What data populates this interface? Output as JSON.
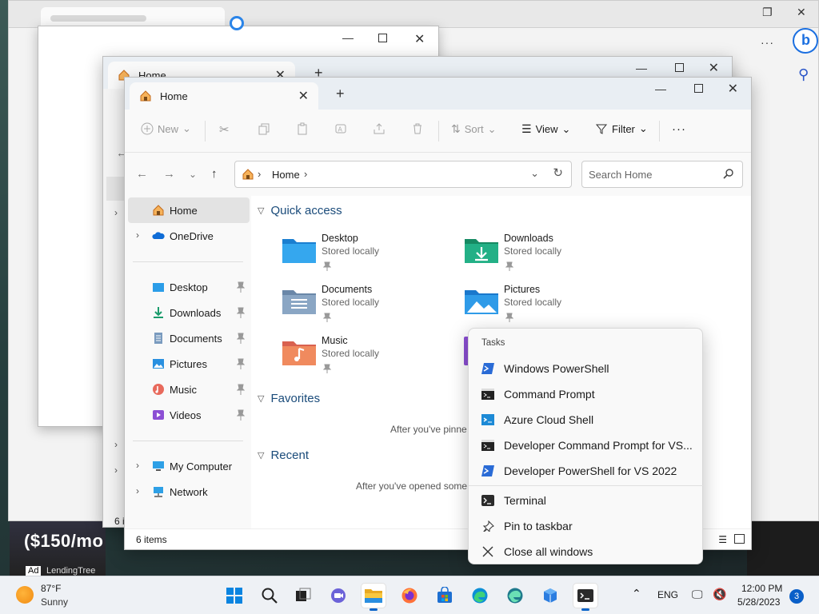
{
  "explorer": {
    "tab_title": "Home",
    "back_tab_title": "Home",
    "new_tab_symbol": "+",
    "toolbar": {
      "new": "New",
      "sort": "Sort",
      "view": "View",
      "filter": "Filter",
      "more": "···"
    },
    "address": {
      "crumb": "Home",
      "search_placeholder": "Search Home"
    },
    "nav": {
      "items": [
        {
          "label": "Home",
          "icon": "home-icon",
          "selected": true
        },
        {
          "label": "OneDrive",
          "icon": "onedrive-icon"
        },
        {
          "label": "Desktop",
          "icon": "desktop-folder-icon",
          "pinned": true
        },
        {
          "label": "Downloads",
          "icon": "downloads-folder-icon",
          "pinned": true
        },
        {
          "label": "Documents",
          "icon": "documents-folder-icon",
          "pinned": true
        },
        {
          "label": "Pictures",
          "icon": "pictures-folder-icon",
          "pinned": true
        },
        {
          "label": "Music",
          "icon": "music-folder-icon",
          "pinned": true
        },
        {
          "label": "Videos",
          "icon": "videos-folder-icon",
          "pinned": true
        },
        {
          "label": "My Computer",
          "icon": "computer-icon"
        },
        {
          "label": "Network",
          "icon": "network-icon"
        }
      ]
    },
    "content": {
      "quick_access": "Quick access",
      "favorites": "Favorites",
      "recent": "Recent",
      "favorites_empty": "After you've pinne",
      "recent_empty": "After you've opened some",
      "tiles": [
        {
          "name": "Desktop",
          "sub": "Stored locally"
        },
        {
          "name": "Downloads",
          "sub": "Stored locally"
        },
        {
          "name": "Documents",
          "sub": "Stored locally"
        },
        {
          "name": "Pictures",
          "sub": "Stored locally"
        },
        {
          "name": "Music",
          "sub": "Stored locally"
        }
      ]
    },
    "status": {
      "count": "6 items"
    }
  },
  "jumplist": {
    "header": "Tasks",
    "items": [
      {
        "label": "Windows PowerShell",
        "icon": "powershell-icon"
      },
      {
        "label": "Command Prompt",
        "icon": "cmd-icon"
      },
      {
        "label": "Azure Cloud Shell",
        "icon": "azure-icon"
      },
      {
        "label": "Developer Command Prompt for VS...",
        "icon": "cmd-icon"
      },
      {
        "label": "Developer PowerShell for VS 2022",
        "icon": "powershell-icon"
      }
    ],
    "actions": [
      {
        "label": "Terminal",
        "icon": "terminal-icon"
      },
      {
        "label": "Pin to taskbar",
        "icon": "pin-icon"
      },
      {
        "label": "Close all windows",
        "icon": "close-icon"
      }
    ]
  },
  "background": {
    "ad_text": "($150/mo",
    "ad_tag": "Ad",
    "ad_brand": "LendingTree",
    "back_window_status": "6 i"
  },
  "taskbar": {
    "weather_temp": "87°F",
    "weather_cond": "Sunny",
    "lang": "ENG",
    "time": "12:00 PM",
    "date": "5/28/2023",
    "notifications": "3"
  },
  "colors": {
    "accent": "#0a64c9",
    "folder_header": "#1a4b7a"
  }
}
